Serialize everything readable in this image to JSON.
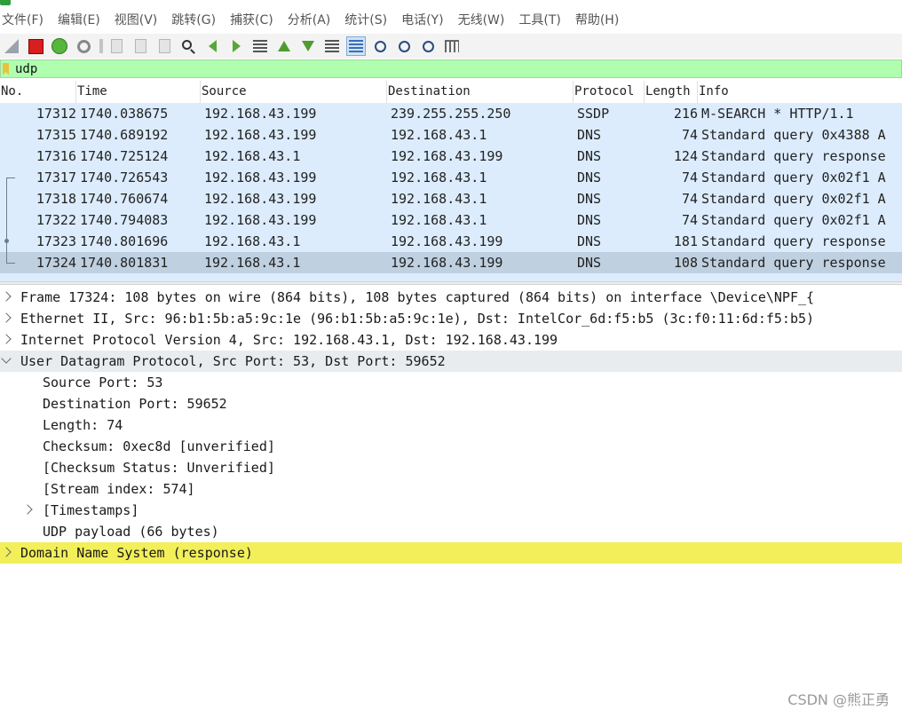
{
  "menu": [
    "文件(F)",
    "编辑(E)",
    "视图(V)",
    "跳转(G)",
    "捕获(C)",
    "分析(A)",
    "统计(S)",
    "电话(Y)",
    "无线(W)",
    "工具(T)",
    "帮助(H)"
  ],
  "filter": {
    "value": "udp"
  },
  "packet_list": {
    "columns": [
      "No.",
      "Time",
      "Source",
      "Destination",
      "Protocol",
      "Length",
      "Info"
    ],
    "rows": [
      {
        "no": "17312",
        "time": "1740.038675",
        "src": "192.168.43.199",
        "dst": "239.255.255.250",
        "proto": "SSDP",
        "len": "216",
        "info": "M-SEARCH * HTTP/1.1"
      },
      {
        "no": "17315",
        "time": "1740.689192",
        "src": "192.168.43.199",
        "dst": "192.168.43.1",
        "proto": "DNS",
        "len": "74",
        "info": "Standard query 0x4388 A"
      },
      {
        "no": "17316",
        "time": "1740.725124",
        "src": "192.168.43.1",
        "dst": "192.168.43.199",
        "proto": "DNS",
        "len": "124",
        "info": "Standard query response"
      },
      {
        "no": "17317",
        "time": "1740.726543",
        "src": "192.168.43.199",
        "dst": "192.168.43.1",
        "proto": "DNS",
        "len": "74",
        "info": "Standard query 0x02f1 A"
      },
      {
        "no": "17318",
        "time": "1740.760674",
        "src": "192.168.43.199",
        "dst": "192.168.43.1",
        "proto": "DNS",
        "len": "74",
        "info": "Standard query 0x02f1 A"
      },
      {
        "no": "17322",
        "time": "1740.794083",
        "src": "192.168.43.199",
        "dst": "192.168.43.1",
        "proto": "DNS",
        "len": "74",
        "info": "Standard query 0x02f1 A"
      },
      {
        "no": "17323",
        "time": "1740.801696",
        "src": "192.168.43.1",
        "dst": "192.168.43.199",
        "proto": "DNS",
        "len": "181",
        "info": "Standard query response"
      },
      {
        "no": "17324",
        "time": "1740.801831",
        "src": "192.168.43.1",
        "dst": "192.168.43.199",
        "proto": "DNS",
        "len": "108",
        "info": "Standard query response"
      }
    ]
  },
  "details": {
    "frame": "Frame 17324: 108 bytes on wire (864 bits), 108 bytes captured (864 bits) on interface \\Device\\NPF_{",
    "ethernet": "Ethernet II, Src: 96:b1:5b:a5:9c:1e (96:b1:5b:a5:9c:1e), Dst: IntelCor_6d:f5:b5 (3c:f0:11:6d:f5:b5)",
    "ip": "Internet Protocol Version 4, Src: 192.168.43.1, Dst: 192.168.43.199",
    "udp": "User Datagram Protocol, Src Port: 53, Dst Port: 59652",
    "udp_fields": {
      "src_port": "Source Port: 53",
      "dst_port": "Destination Port: 59652",
      "length": "Length: 74",
      "checksum": "Checksum: 0xec8d [unverified]",
      "checksum_status": "[Checksum Status: Unverified]",
      "stream_index": "[Stream index: 574]",
      "timestamps": "[Timestamps]",
      "payload": "UDP payload (66 bytes)"
    },
    "dns": "Domain Name System (response)"
  },
  "watermark": "CSDN @熊正勇",
  "colors": {
    "filter_bg": "#afffaf",
    "row_bg": "#dcecfd",
    "selected_row_bg": "#bfd0e0",
    "highlight_yellow": "#f2ef5a"
  }
}
